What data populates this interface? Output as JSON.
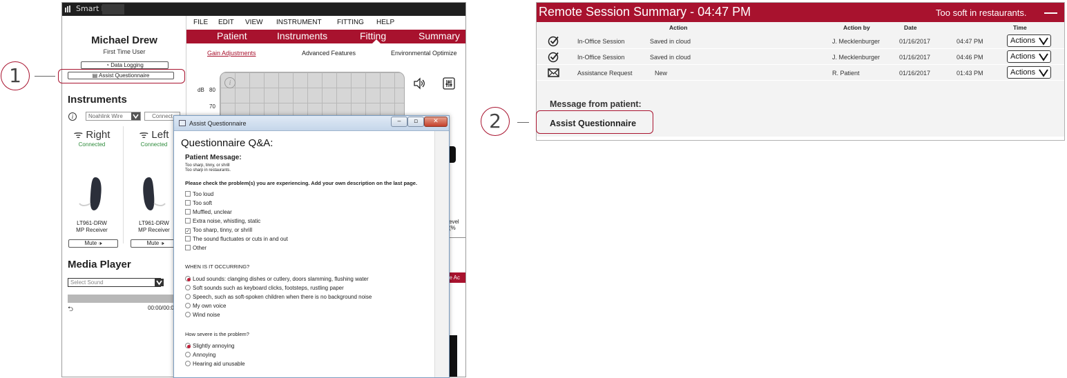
{
  "callouts": {
    "one": "1",
    "two": "2"
  },
  "app": {
    "title": "Smart Fit",
    "patient": {
      "name": "Michael Drew",
      "type": "First Time User"
    },
    "sidebar": {
      "data_logging": "Data Logging",
      "assist_questionnaire": "Assist Questionnaire",
      "instruments_heading": "Instruments",
      "noahlink": "Noahlink Wire",
      "connect": "Connect",
      "right": {
        "label": "Right",
        "status": "Connected",
        "model_line1": "LT961-DRW",
        "model_line2": "MP Receiver",
        "mute": "Mute"
      },
      "left": {
        "label": "Left",
        "status": "Connected",
        "model_line1": "LT961-DRW",
        "model_line2": "MP Receiver",
        "mute": "Mute"
      },
      "media_heading": "Media Player",
      "select_sound_placeholder": "Select Sound",
      "media_time": "00:00/00:0"
    },
    "menu": [
      "FILE",
      "EDIT",
      "VIEW",
      "INSTRUMENT",
      "FITTING",
      "HELP"
    ],
    "tabs": [
      "Patient",
      "Instruments",
      "Fitting",
      "Summary"
    ],
    "subtabs": [
      "Gain Adjustments",
      "Advanced Features",
      "Environmental Optimize"
    ],
    "graph": {
      "db_label": "dB",
      "y_top": "80",
      "y_second": "70"
    },
    "level_label": "evel (%",
    "red_chip": "ne Ac"
  },
  "dialog": {
    "title": "Assist Questionnaire",
    "heading": "Questionnaire Q&A:",
    "patient_message_label": "Patient Message:",
    "patient_message": [
      "Too sharp, tinny, or shrill",
      "Too sharp in restaurants."
    ],
    "instructions": "Please check the problem(s) you are experiencing. Add your own description on the last page.",
    "problems": [
      {
        "label": "Too loud",
        "checked": false
      },
      {
        "label": "Too soft",
        "checked": false
      },
      {
        "label": "Muffled, unclear",
        "checked": false
      },
      {
        "label": "Extra noise, whistling, static",
        "checked": false
      },
      {
        "label": "Too sharp, tinny, or shrill",
        "checked": true
      },
      {
        "label": "The sound fluctuates or cuts in and out",
        "checked": false
      },
      {
        "label": "Other",
        "checked": false
      }
    ],
    "when_question": "WHEN IS IT OCCURRING?",
    "when_options": [
      {
        "label": "Loud sounds: clanging dishes or cutlery, doors slamming, flushing water",
        "selected": true
      },
      {
        "label": "Soft sounds such as keyboard clicks, footsteps, rustling paper",
        "selected": false
      },
      {
        "label": "Speech, such as soft-spoken children when there is no background noise",
        "selected": false
      },
      {
        "label": "My own voice",
        "selected": false
      },
      {
        "label": "Wind noise",
        "selected": false
      }
    ],
    "severity_question": "How severe is the problem?",
    "severity_options": [
      {
        "label": "Slightly annoying",
        "selected": true
      },
      {
        "label": "Annoying",
        "selected": false
      },
      {
        "label": "Hearing aid unusable",
        "selected": false
      }
    ]
  },
  "remote_summary": {
    "title": "Remote Session Summary - 04:47 PM",
    "patient_message_preview": "Too soft in restaurants.",
    "columns": {
      "action": "Action",
      "action_by": "Action by",
      "date": "Date",
      "time": "Time"
    },
    "rows": [
      {
        "icon": "check-circle-icon",
        "type": "In-Office Session",
        "action": "Saved in cloud",
        "by": "J. Mecklenburger",
        "date": "01/16/2017",
        "time": "04:47 PM",
        "button": "Actions"
      },
      {
        "icon": "check-circle-icon",
        "type": "In-Office Session",
        "action": "Saved in cloud",
        "by": "J. Mecklenburger",
        "date": "01/16/2017",
        "time": "04:46 PM",
        "button": "Actions"
      },
      {
        "icon": "envelope-icon",
        "type": "Assistance Request",
        "action": "New",
        "by": "R. Patient",
        "date": "01/16/2017",
        "time": "01:43 PM",
        "button": "Actions"
      }
    ],
    "message_label": "Message from patient:",
    "assist_label": "Assist Questionnaire"
  },
  "colors": {
    "brand_red": "#a8122e",
    "connected_green": "#2c8a3a"
  }
}
